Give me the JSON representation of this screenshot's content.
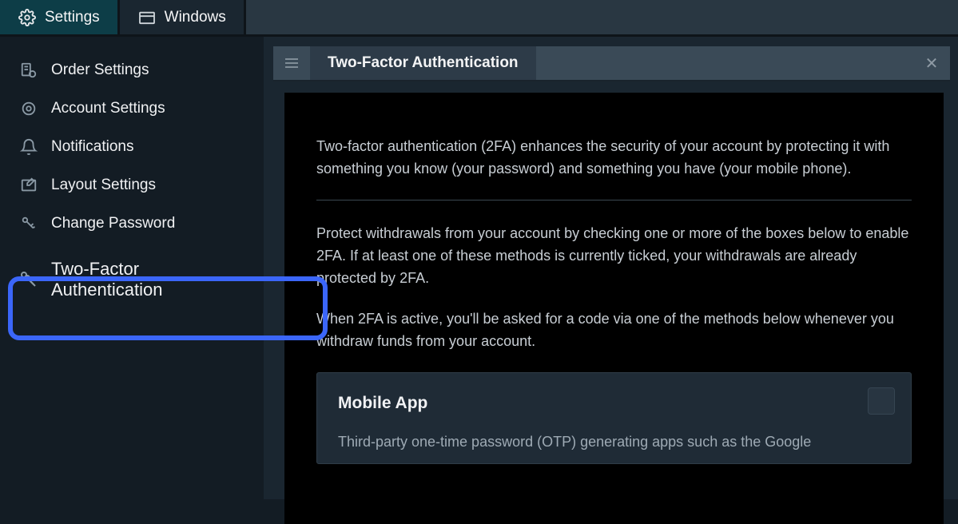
{
  "topbar": {
    "settings_label": "Settings",
    "windows_label": "Windows"
  },
  "sidebar": {
    "items": [
      {
        "label": "Order Settings"
      },
      {
        "label": "Account Settings"
      },
      {
        "label": "Notifications"
      },
      {
        "label": "Layout Settings"
      },
      {
        "label": "Change Password"
      },
      {
        "label": "Two-Factor Authentication"
      }
    ]
  },
  "panel": {
    "title": "Two-Factor Authentication",
    "intro": "Two-factor authentication (2FA) enhances the security of your account by protecting it with something you know (your password) and something you have (your mobile phone).",
    "protect_text": "Protect withdrawals from your account by checking one or more of the boxes below to enable 2FA. If at least one of these methods is currently ticked, your withdrawals are already protected by 2FA.",
    "when_active_text": "When 2FA is active, you'll be asked for a code via one of the methods below whenever you withdraw funds from your account.",
    "option": {
      "title": "Mobile App",
      "description": "Third-party one-time password (OTP) generating apps such as the Google"
    }
  }
}
